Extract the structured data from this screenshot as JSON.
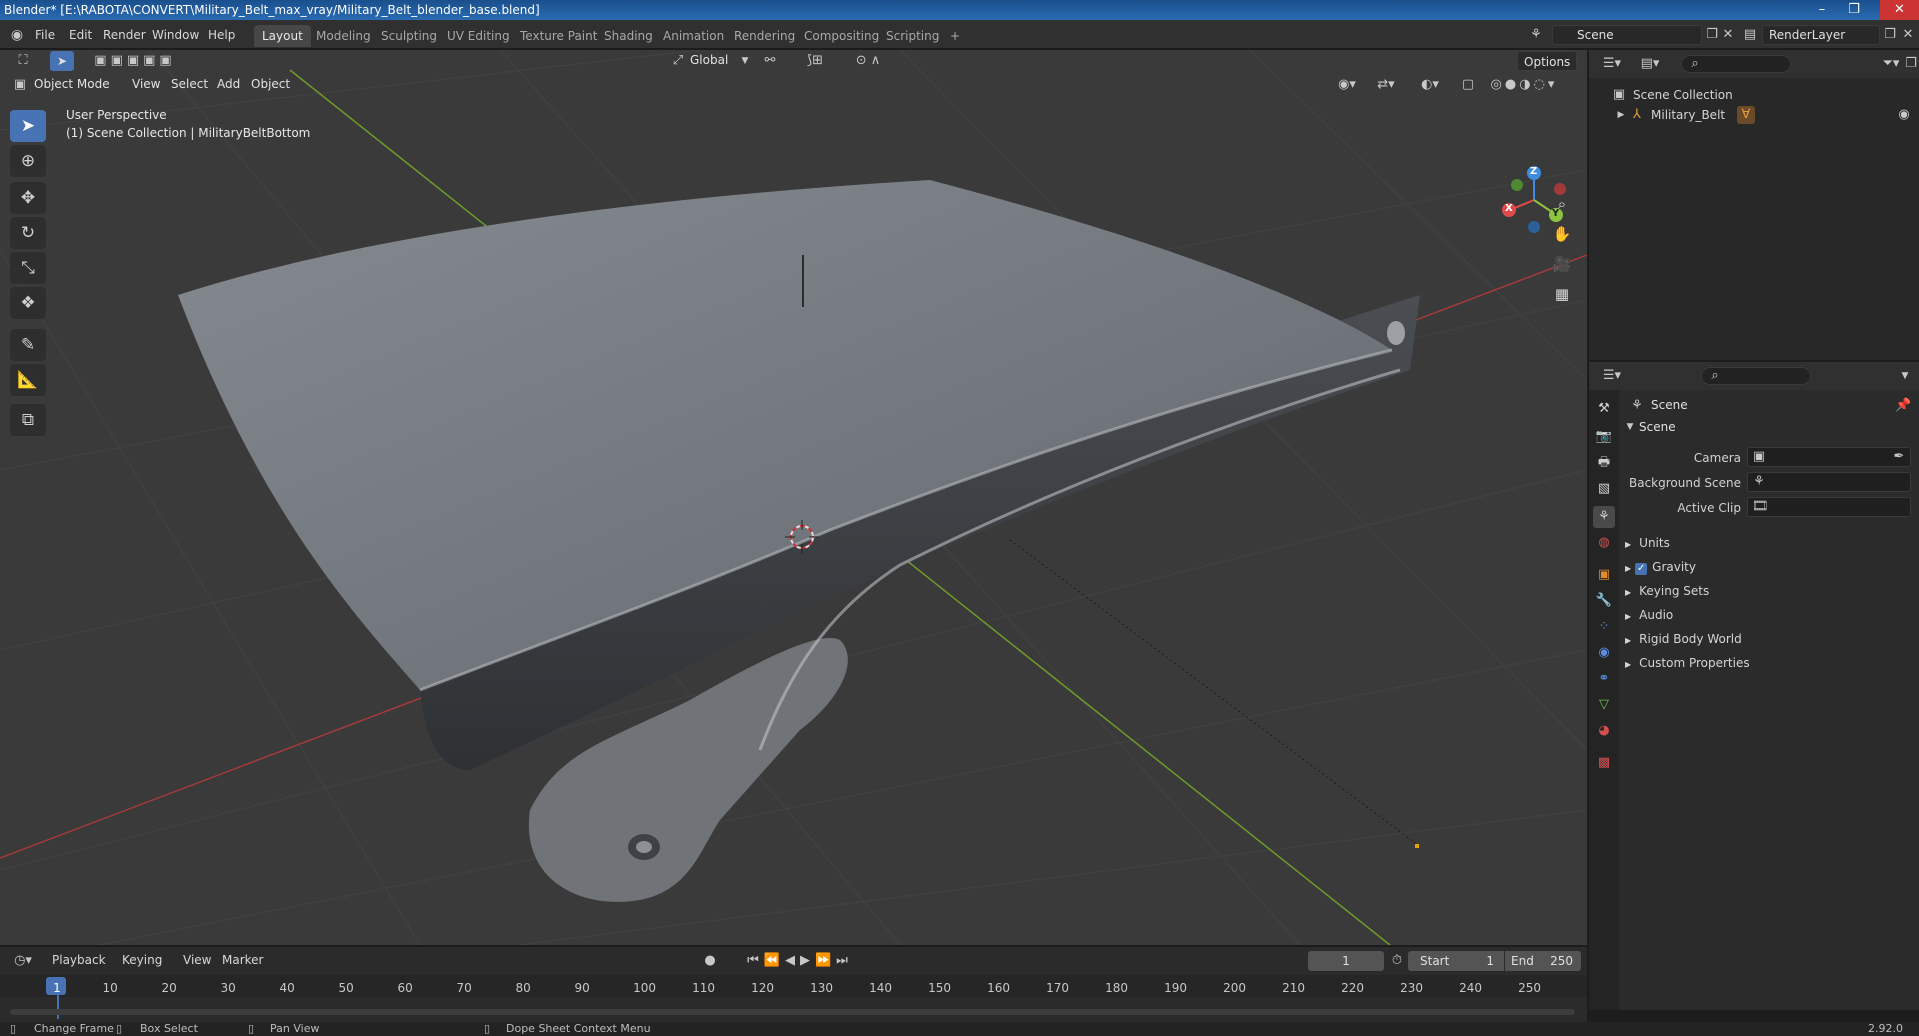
{
  "window": {
    "title": "Blender* [E:\\RABOTA\\CONVERT\\Military_Belt_max_vray/Military_Belt_blender_base.blend]",
    "minimize": "–",
    "maximize": "❐",
    "close": "✕"
  },
  "menu": {
    "items": [
      "File",
      "Edit",
      "Render",
      "Window",
      "Help"
    ]
  },
  "workspaces": [
    "Layout",
    "Modeling",
    "Sculpting",
    "UV Editing",
    "Texture Paint",
    "Shading",
    "Animation",
    "Rendering",
    "Compositing",
    "Scripting",
    "+"
  ],
  "active_workspace": "Layout",
  "scene_field": "Scene",
  "renderlayer_field": "RenderLayer",
  "viewport": {
    "transform_orientation": "Global",
    "options_label": "Options",
    "mode": "Object Mode",
    "header_menus": [
      "View",
      "Select",
      "Add",
      "Object"
    ],
    "overlay_line1": "User Perspective",
    "overlay_line2": "(1) Scene Collection | MilitaryBeltBottom",
    "gizmo": {
      "x": "X",
      "y": "Y",
      "z": "Z"
    }
  },
  "outliner": {
    "root": "Scene Collection",
    "items": [
      {
        "name": "Military_Belt"
      }
    ]
  },
  "properties": {
    "context_title": "Scene",
    "panel_title": "Scene",
    "fields": [
      {
        "label": "Camera"
      },
      {
        "label": "Background Scene"
      },
      {
        "label": "Active Clip"
      }
    ],
    "subpanels": [
      "Units",
      "Gravity",
      "Keying Sets",
      "Audio",
      "Rigid Body World",
      "Custom Properties"
    ],
    "gravity_enabled": true
  },
  "timeline": {
    "menus": [
      "Playback",
      "Keying",
      "View",
      "Marker"
    ],
    "current_frame": "1",
    "start_label": "Start",
    "start_value": "1",
    "end_label": "End",
    "end_value": "250",
    "ruler": [
      "1",
      "10",
      "20",
      "30",
      "40",
      "50",
      "60",
      "70",
      "80",
      "90",
      "100",
      "110",
      "120",
      "130",
      "140",
      "150",
      "160",
      "170",
      "180",
      "190",
      "200",
      "210",
      "220",
      "230",
      "240",
      "250"
    ]
  },
  "statusbar": {
    "items": [
      "Change Frame",
      "Box Select",
      "Pan View",
      "Dope Sheet Context Menu"
    ],
    "version": "2.92.0"
  },
  "colors": {
    "accent": "#4772b3",
    "x_axis": "#e04a4a",
    "y_axis": "#8bc43f",
    "z_axis": "#3e8be0"
  }
}
